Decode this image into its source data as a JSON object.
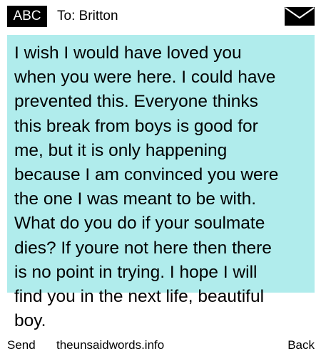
{
  "header": {
    "mode": "ABC",
    "recipient": "To: Britton",
    "icon": "envelope-icon"
  },
  "message": {
    "text": "I wish I would have loved you\nwhen you were here. I could have\nprevented this. Everyone thinks\nthis break from boys is good for\nme, but it is only happening\nbecause I am convinced you were\nthe one I was meant to be with.\nWhat do you do if your soulmate\ndies? If youre not here then there\nis no point in trying. I hope I will\nfind you in the next life, beautiful\nboy."
  },
  "footer": {
    "left": "Send",
    "center": "theunsaidwords.info",
    "right": "Back"
  },
  "colors": {
    "message_background": "#b0ecec",
    "badge_background": "#000000",
    "badge_text": "#ffffff"
  }
}
